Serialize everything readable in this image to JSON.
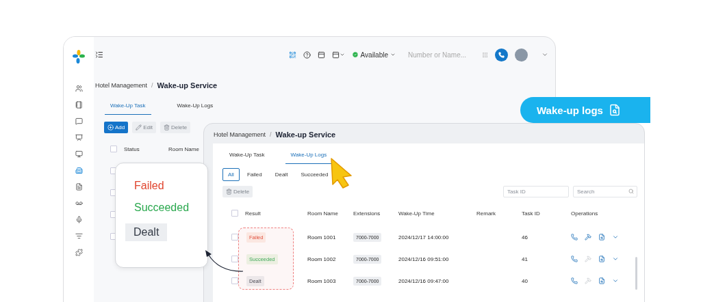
{
  "back_window": {
    "topbar": {
      "status": "Available",
      "search_placeholder": "Number or Name..."
    },
    "breadcrumb": {
      "parent": "Hotel Management",
      "separator": "/",
      "current": "Wake-up Service"
    },
    "tabs": [
      {
        "label": "Wake-Up Task",
        "selected": true
      },
      {
        "label": "Wake-Up Logs",
        "selected": false
      }
    ],
    "buttons": [
      {
        "label": "Add",
        "disabled": false
      },
      {
        "label": "Edit",
        "disabled": true
      },
      {
        "label": "Delete",
        "disabled": true
      }
    ],
    "select_all_checked": false,
    "columns": [
      "Status",
      "Room Name"
    ],
    "rows": [
      {
        "checked": false
      },
      {
        "checked": false
      },
      {
        "checked": false
      },
      {
        "checked": false
      }
    ]
  },
  "callout": {
    "label": "Wake-up logs"
  },
  "front_window": {
    "breadcrumb": {
      "parent": "Hotel Management",
      "separator": "/",
      "current": "Wake-up Service"
    },
    "select_all_checked": false,
    "tabs": [
      {
        "label": "Wake-Up Task",
        "selected": false
      },
      {
        "label": "Wake-Up Logs",
        "selected": true
      }
    ],
    "filters": [
      {
        "label": "All",
        "selected": true
      },
      {
        "label": "Failed",
        "selected": false
      },
      {
        "label": "Dealt",
        "selected": false
      },
      {
        "label": "Succeeded",
        "selected": false
      }
    ],
    "delete_button": {
      "label": "Delete",
      "disabled": true
    },
    "task_id_placeholder": "Task ID",
    "search_placeholder": "Search",
    "columns": [
      "Result",
      "Room Name",
      "Extensions",
      "Wake-Up Time",
      "Remark",
      "Task ID",
      "Operations"
    ],
    "rows": [
      {
        "result": "Failed",
        "kind": "failed",
        "room": "Room 1001",
        "extension": "7000-7000",
        "time": "2024/12/17 14:00:00",
        "task_id": "46",
        "checked": false,
        "second_action_disabled": false
      },
      {
        "result": "Succeeded",
        "kind": "succeeded",
        "room": "Room 1002",
        "extension": "7000-7000",
        "time": "2024/12/16 09:51:00",
        "task_id": "41",
        "checked": false,
        "second_action_disabled": true
      },
      {
        "result": "Dealt",
        "kind": "dealt",
        "room": "Room 1003",
        "extension": "7000-7000",
        "time": "2024/12/16 09:47:00",
        "task_id": "40",
        "checked": false,
        "second_action_disabled": true
      }
    ]
  },
  "popup": {
    "items": [
      {
        "label": "Failed",
        "kind": "failed"
      },
      {
        "label": "Succeeded",
        "kind": "succeeded"
      },
      {
        "label": "Dealt",
        "kind": "dealt"
      }
    ]
  }
}
